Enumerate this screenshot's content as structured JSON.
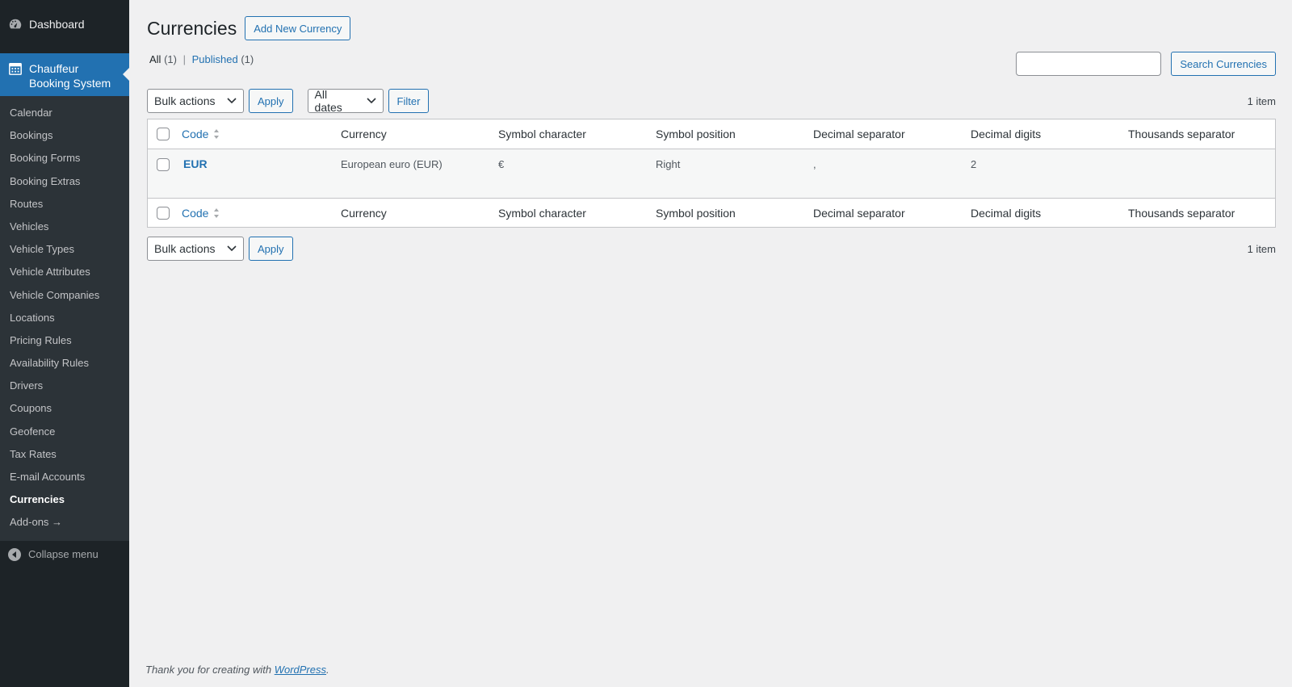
{
  "sidebar": {
    "dashboard_label": "Dashboard",
    "current_menu_label": "Chauffeur Booking System",
    "items": [
      {
        "label": "Calendar"
      },
      {
        "label": "Bookings"
      },
      {
        "label": "Booking Forms"
      },
      {
        "label": "Booking Extras"
      },
      {
        "label": "Routes"
      },
      {
        "label": "Vehicles"
      },
      {
        "label": "Vehicle Types"
      },
      {
        "label": "Vehicle Attributes"
      },
      {
        "label": "Vehicle Companies"
      },
      {
        "label": "Locations"
      },
      {
        "label": "Pricing Rules"
      },
      {
        "label": "Availability Rules"
      },
      {
        "label": "Drivers"
      },
      {
        "label": "Coupons"
      },
      {
        "label": "Geofence"
      },
      {
        "label": "Tax Rates"
      },
      {
        "label": "E-mail Accounts"
      },
      {
        "label": "Currencies",
        "current": true
      },
      {
        "label": "Add-ons →"
      }
    ],
    "collapse_label": "Collapse menu"
  },
  "header": {
    "title": "Currencies",
    "add_new_label": "Add New Currency"
  },
  "views": {
    "all_label": "All",
    "all_count": "(1)",
    "separator": "|",
    "published_label": "Published",
    "published_count": "(1)"
  },
  "search": {
    "value": "",
    "button_label": "Search Currencies"
  },
  "tablenav_top": {
    "bulk_actions": "Bulk actions",
    "apply_label": "Apply",
    "dates_filter": "All dates",
    "filter_label": "Filter",
    "items_count": "1 item"
  },
  "table": {
    "columns": [
      "Code",
      "Currency",
      "Symbol character",
      "Symbol position",
      "Decimal separator",
      "Decimal digits",
      "Thousands separator"
    ],
    "rows": [
      {
        "code": "EUR",
        "currency": "European euro (EUR)",
        "symbol_character": "€",
        "symbol_position": "Right",
        "decimal_separator": ",",
        "decimal_digits": "2",
        "thousands_separator": ""
      }
    ]
  },
  "tablenav_bottom": {
    "bulk_actions": "Bulk actions",
    "apply_label": "Apply",
    "items_count": "1 item"
  },
  "footer": {
    "text_before": "Thank you for creating with",
    "link_label": "WordPress",
    "text_after": "."
  },
  "colors": {
    "accent": "#2271b1",
    "sidebar_bg": "#1d2327",
    "submenu_bg": "#2c3338",
    "page_bg": "#f0f0f1"
  }
}
